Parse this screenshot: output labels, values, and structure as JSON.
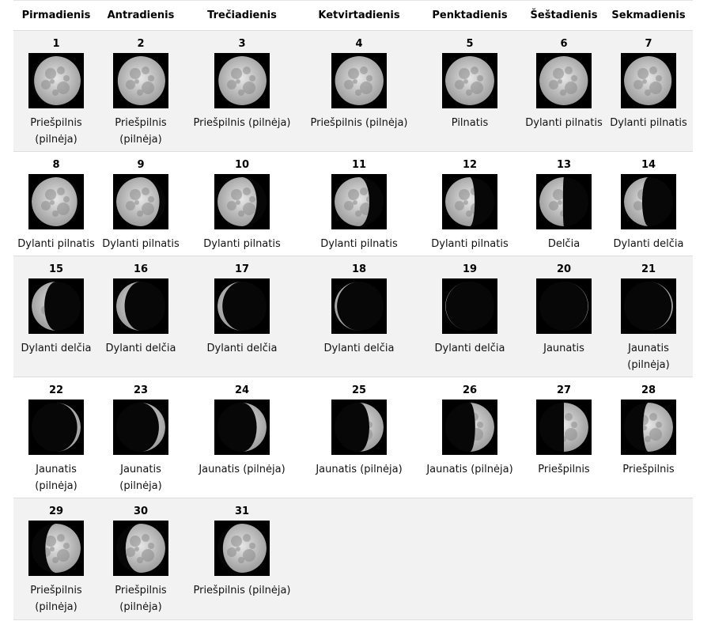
{
  "weekdays": [
    "Pirmadienis",
    "Antradienis",
    "Trečiadienis",
    "Ketvirtadienis",
    "Penktadienis",
    "Šeštadienis",
    "Sekmadienis"
  ],
  "days": [
    {
      "day": "1",
      "phase": "Priešpilnis (pilnėja)",
      "illum": 0.95,
      "waxing": true
    },
    {
      "day": "2",
      "phase": "Priešpilnis (pilnėja)",
      "illum": 0.97,
      "waxing": true
    },
    {
      "day": "3",
      "phase": "Priešpilnis (pilnėja)",
      "illum": 0.98,
      "waxing": true
    },
    {
      "day": "4",
      "phase": "Priešpilnis (pilnėja)",
      "illum": 0.99,
      "waxing": true
    },
    {
      "day": "5",
      "phase": "Pilnatis",
      "illum": 1.0,
      "waxing": true
    },
    {
      "day": "6",
      "phase": "Dylanti pilnatis",
      "illum": 0.99,
      "waxing": false
    },
    {
      "day": "7",
      "phase": "Dylanti pilnatis",
      "illum": 0.97,
      "waxing": false
    },
    {
      "day": "8",
      "phase": "Dylanti pilnatis",
      "illum": 0.93,
      "waxing": false
    },
    {
      "day": "9",
      "phase": "Dylanti pilnatis",
      "illum": 0.88,
      "waxing": false
    },
    {
      "day": "10",
      "phase": "Dylanti pilnatis",
      "illum": 0.8,
      "waxing": false
    },
    {
      "day": "11",
      "phase": "Dylanti pilnatis",
      "illum": 0.71,
      "waxing": false
    },
    {
      "day": "12",
      "phase": "Dylanti pilnatis",
      "illum": 0.6,
      "waxing": false
    },
    {
      "day": "13",
      "phase": "Delčia",
      "illum": 0.48,
      "waxing": false
    },
    {
      "day": "14",
      "phase": "Dylanti delčia",
      "illum": 0.37,
      "waxing": false
    },
    {
      "day": "15",
      "phase": "Dylanti delčia",
      "illum": 0.26,
      "waxing": false
    },
    {
      "day": "16",
      "phase": "Dylanti delčia",
      "illum": 0.17,
      "waxing": false
    },
    {
      "day": "17",
      "phase": "Dylanti delčia",
      "illum": 0.1,
      "waxing": false
    },
    {
      "day": "18",
      "phase": "Dylanti delčia",
      "illum": 0.05,
      "waxing": false
    },
    {
      "day": "19",
      "phase": "Dylanti delčia",
      "illum": 0.01,
      "waxing": false
    },
    {
      "day": "20",
      "phase": "Jaunatis",
      "illum": 0.01,
      "waxing": true
    },
    {
      "day": "21",
      "phase": "Jaunatis (pilnėja)",
      "illum": 0.03,
      "waxing": true
    },
    {
      "day": "22",
      "phase": "Jaunatis (pilnėja)",
      "illum": 0.07,
      "waxing": true
    },
    {
      "day": "23",
      "phase": "Jaunatis (pilnėja)",
      "illum": 0.13,
      "waxing": true
    },
    {
      "day": "24",
      "phase": "Jaunatis (pilnėja)",
      "illum": 0.2,
      "waxing": true
    },
    {
      "day": "25",
      "phase": "Jaunatis (pilnėja)",
      "illum": 0.29,
      "waxing": true
    },
    {
      "day": "26",
      "phase": "Jaunatis (pilnėja)",
      "illum": 0.39,
      "waxing": true
    },
    {
      "day": "27",
      "phase": "Priešpilnis",
      "illum": 0.5,
      "waxing": true
    },
    {
      "day": "28",
      "phase": "Priešpilnis",
      "illum": 0.61,
      "waxing": true
    },
    {
      "day": "29",
      "phase": "Priešpilnis (pilnėja)",
      "illum": 0.72,
      "waxing": true
    },
    {
      "day": "30",
      "phase": "Priešpilnis (pilnėja)",
      "illum": 0.81,
      "waxing": true
    },
    {
      "day": "31",
      "phase": "Priešpilnis (pilnėja)",
      "illum": 0.89,
      "waxing": true
    }
  ]
}
